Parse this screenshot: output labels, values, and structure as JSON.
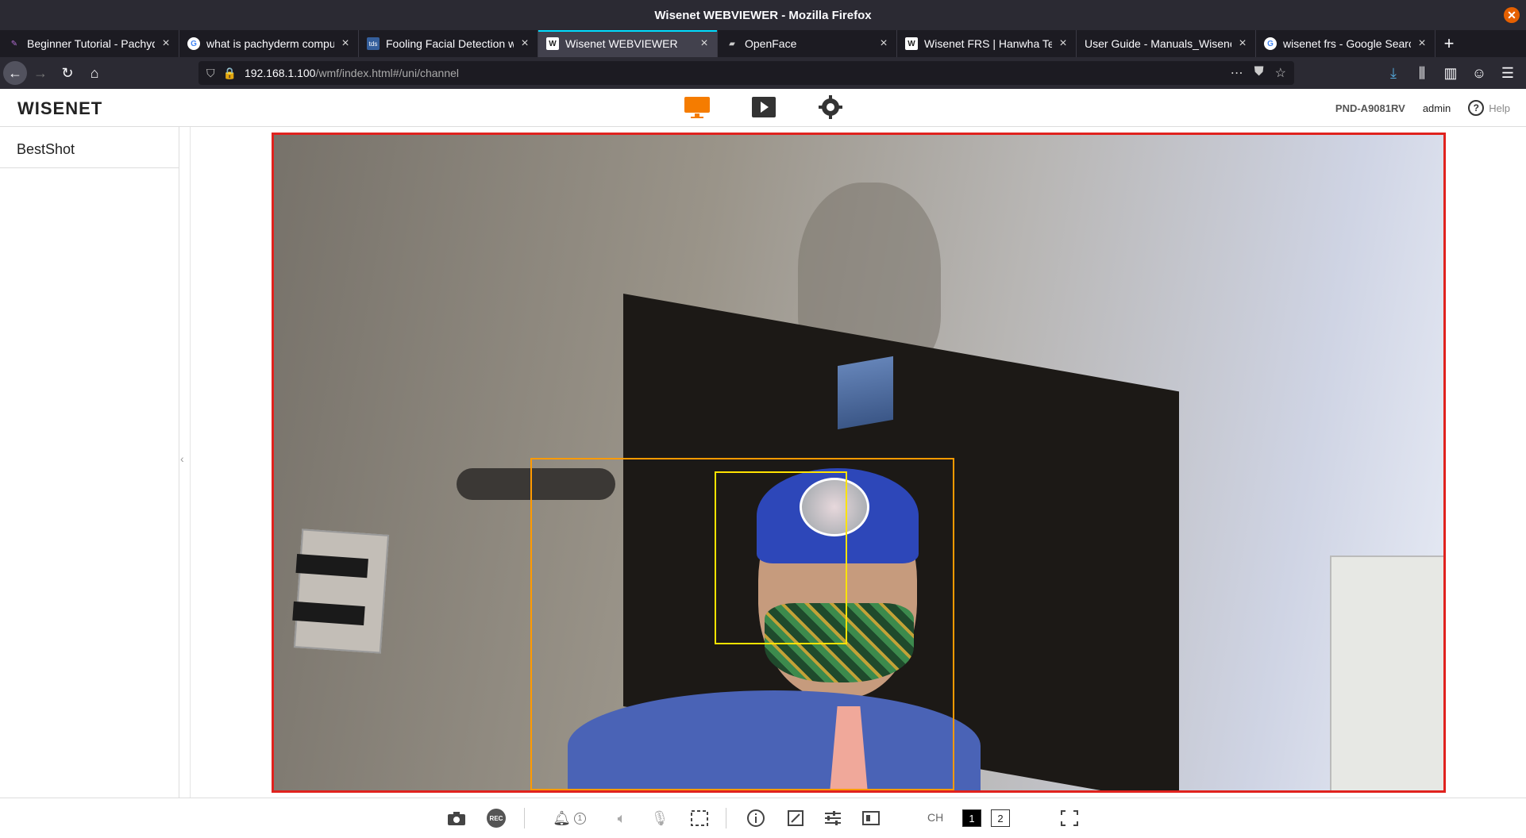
{
  "window": {
    "title": "Wisenet WEBVIEWER - Mozilla Firefox"
  },
  "tabs": [
    {
      "label": "Beginner Tutorial - Pachyderm",
      "icon": "pachyderm-favicon-icon"
    },
    {
      "label": "what is pachyderm computing",
      "icon": "google-favicon-icon"
    },
    {
      "label": "Fooling Facial Detection with",
      "icon": "tds-favicon-icon"
    },
    {
      "label": "Wisenet WEBVIEWER",
      "icon": "wisenet-favicon-icon",
      "active": true
    },
    {
      "label": "OpenFace",
      "icon": "openface-favicon-icon"
    },
    {
      "label": "Wisenet FRS | Hanwha Tech",
      "icon": "wisenet-favicon-icon"
    },
    {
      "label": "User Guide - Manuals_Wisenet",
      "icon": "none"
    },
    {
      "label": "wisenet frs - Google Search",
      "icon": "google-favicon-icon"
    }
  ],
  "urlbar": {
    "host": "192.168.1.100",
    "path": "/wmf/index.html#/uni/channel"
  },
  "app": {
    "logo": "WISENET",
    "model": "PND-A9081RV",
    "user": "admin",
    "help_label": "Help",
    "help_glyph": "?",
    "sidebar_title": "BestShot"
  },
  "bottom": {
    "rec_label": "REC",
    "alarm_count": "1",
    "ch_label": "CH",
    "channels": [
      "1",
      "2"
    ],
    "active_channel": "1"
  },
  "colors": {
    "viewer_border": "#e0221e",
    "body_box": "#ff9a00",
    "face_box": "#ffe300",
    "live_mode_accent": "#f57c00"
  }
}
